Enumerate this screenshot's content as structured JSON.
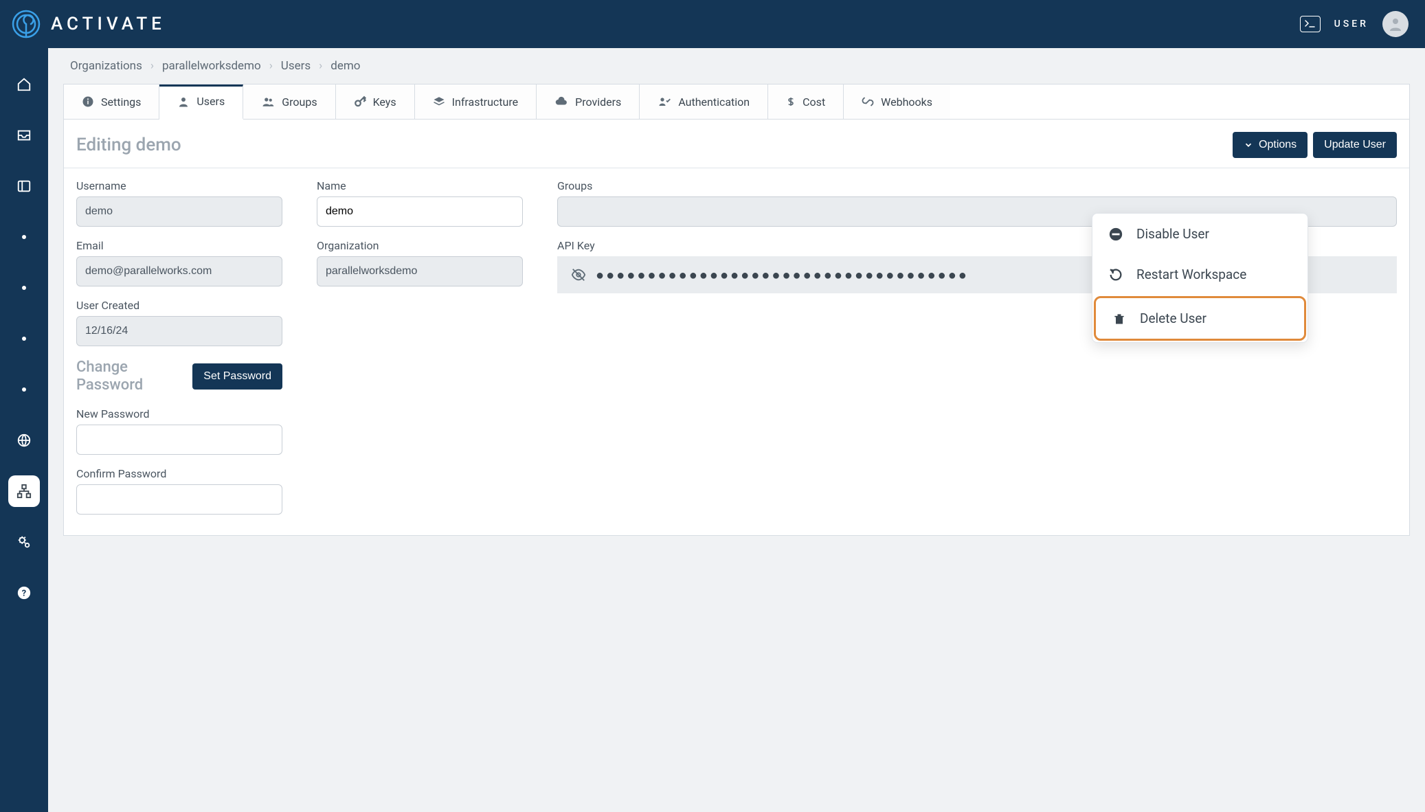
{
  "brand": {
    "name": "ACTIVATE"
  },
  "topbar": {
    "user_label": "USER"
  },
  "breadcrumb": {
    "items": [
      "Organizations",
      "parallelworksdemo",
      "Users",
      "demo"
    ]
  },
  "tabs": {
    "settings": "Settings",
    "users": "Users",
    "groups": "Groups",
    "keys": "Keys",
    "infrastructure": "Infrastructure",
    "providers": "Providers",
    "authentication": "Authentication",
    "cost": "Cost",
    "webhooks": "Webhooks"
  },
  "header": {
    "title": "Editing demo",
    "options_btn": "Options",
    "update_btn": "Update User"
  },
  "form": {
    "username_label": "Username",
    "username_value": "demo",
    "email_label": "Email",
    "email_value": "demo@parallelworks.com",
    "created_label": "User Created",
    "created_value": "12/16/24",
    "name_label": "Name",
    "name_value": "demo",
    "org_label": "Organization",
    "org_value": "parallelworksdemo",
    "groups_label": "Groups",
    "apikey_label": "API Key",
    "apikey_masked": "●●●●●●●●●●●●●●●●●●●●●●●●●●●●●●●●●●●●",
    "change_pw_heading": "Change Password",
    "set_pw_btn": "Set Password",
    "new_pw_label": "New Password",
    "confirm_pw_label": "Confirm Password"
  },
  "dropdown": {
    "disable": "Disable User",
    "restart": "Restart Workspace",
    "delete": "Delete User"
  }
}
